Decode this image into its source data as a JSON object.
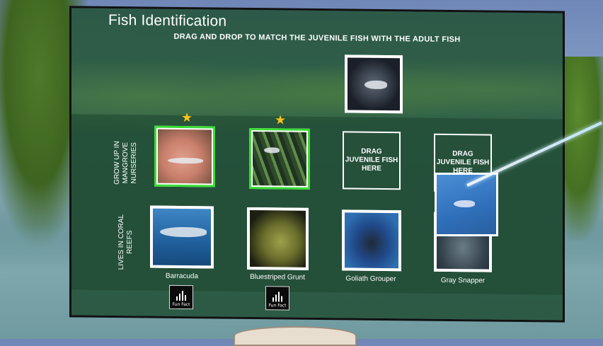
{
  "panel": {
    "title": "Fish Identification",
    "subtitle": "DRAG AND DROP TO MATCH THE JUVENILE FISH WITH THE ADULT FISH"
  },
  "rows": {
    "mangrove_label": "GROW UP IN MANGROVE NURSERIES",
    "coral_label": "LIVES IN CORAL REEFS"
  },
  "drop_slots": [
    {
      "text": "DRAG JUVENILE FISH HERE"
    },
    {
      "text": "DRAG JUVENILE FISH HERE"
    }
  ],
  "adult_fish": [
    {
      "name": "Barracuda",
      "icon": "barracuda-image"
    },
    {
      "name": "Bluestriped Grunt",
      "icon": "bluestriped-grunt-image"
    },
    {
      "name": "Goliath Grouper",
      "icon": "goliath-grouper-image"
    },
    {
      "name": "Gray Snapper",
      "icon": "gray-snapper-image"
    }
  ],
  "fun_fact": {
    "label": "Fun Fact",
    "icon": "audio-bars-icon"
  },
  "star_icon": "star-icon",
  "colors": {
    "match_border": "#3bdc36",
    "star": "#f5c31b",
    "panel": "#2d5a48"
  }
}
